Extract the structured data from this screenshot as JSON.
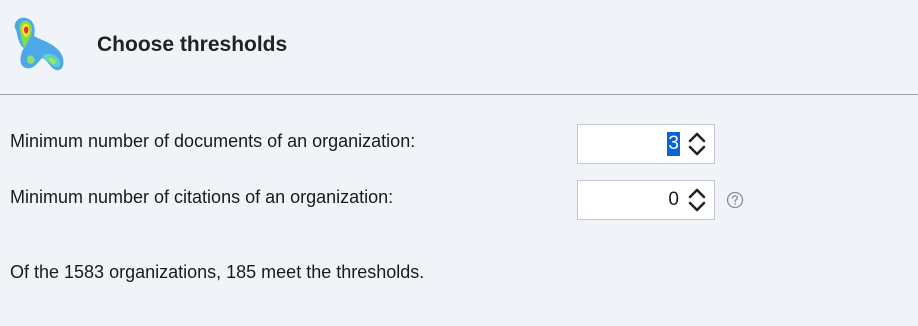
{
  "header": {
    "title": "Choose thresholds",
    "logo_icon": "density-map-logo-icon"
  },
  "thresholds": {
    "documents": {
      "label": "Minimum number of documents of an organization:",
      "value": "3",
      "value_selected": true
    },
    "citations": {
      "label": "Minimum number of citations of an organization:",
      "value": "0",
      "help_icon": "question-mark-icon"
    }
  },
  "summary": {
    "text": "Of the 1583 organizations, 185 meet the thresholds."
  },
  "colors": {
    "background": "#f0f4f9",
    "selection": "#0a64d8",
    "divider": "#9aa0a6"
  }
}
